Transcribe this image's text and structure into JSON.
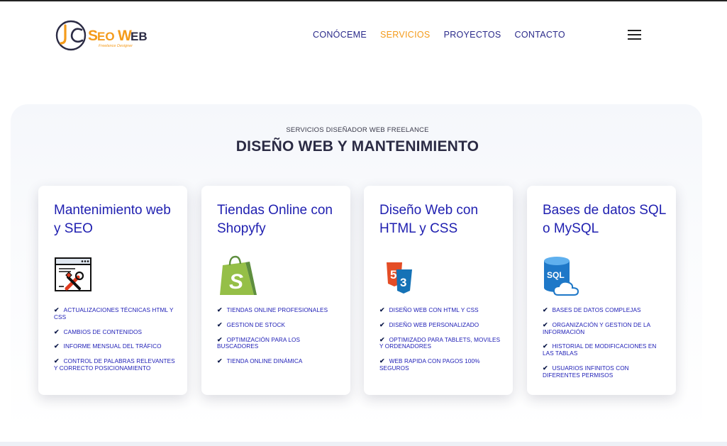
{
  "header": {
    "logo_text_seo": "SeoWeb",
    "logo_tagline": "Freelance Designer",
    "nav": [
      {
        "label": "CONÓCEME",
        "active": false
      },
      {
        "label": "SERVICIOS",
        "active": true
      },
      {
        "label": "PROYECTOS",
        "active": false
      },
      {
        "label": "CONTACTO",
        "active": false
      }
    ],
    "menu_icon": "hamburger-icon"
  },
  "section": {
    "eyebrow": "SERVICIOS DISEÑADOR WEB FREELANCE",
    "title": "DISEÑO WEB Y MANTENIMIENTO"
  },
  "cards": [
    {
      "title": "Mantenimiento web y SEO",
      "icon": "website-tools-icon",
      "items": [
        "ACTUALIZACIONES TÉCNICAS HTML Y CSS",
        "CAMBIOS DE CONTENIDOS",
        "INFORME MENSUAL DEL TRÁFICO",
        "CONTROL DE PALABRAS RELEVANTES Y CORRECTO POSICIONAMIENTO"
      ]
    },
    {
      "title": "Tiendas Online con Shopyfy",
      "icon": "shopify-bag-icon",
      "items": [
        "TIENDAS ONLINE PROFESIONALES",
        "GESTION DE STOCK",
        "OPTIMIZACIÓN PARA LOS BUSCADORES",
        "TIENDA ONLINE DINÁMICA"
      ]
    },
    {
      "title": "Diseño Web con HTML y CSS",
      "icon": "html5-css3-icon",
      "items": [
        "DISEÑO WEB CON HTML Y CSS",
        "DISEÑO WEB PERSONALIZADO",
        "OPTIMIZADO PARA TABLETS, MOVILES Y ORDENADORES",
        "WEB RAPIDA CON PAGOS 100% SEGUROS"
      ]
    },
    {
      "title": "Bases de datos SQL o MySQL",
      "icon": "sql-database-cloud-icon",
      "items": [
        "BASES DE DATOS COMPLEJAS",
        "ORGANIZACIÓN Y GESTION DE LA INFORMACIÓN",
        "HISTORIAL DE MODIFICACIONES EN LAS TABLAS",
        "USUARIOS INFINITOS CON DIFERENTES PERMISOS"
      ]
    }
  ],
  "colors": {
    "accent": "#f49b1b",
    "nav_text": "#2a2a8a",
    "card_title": "#1f1fb0",
    "heading": "#2b2b44"
  },
  "check_glyph": "✔"
}
